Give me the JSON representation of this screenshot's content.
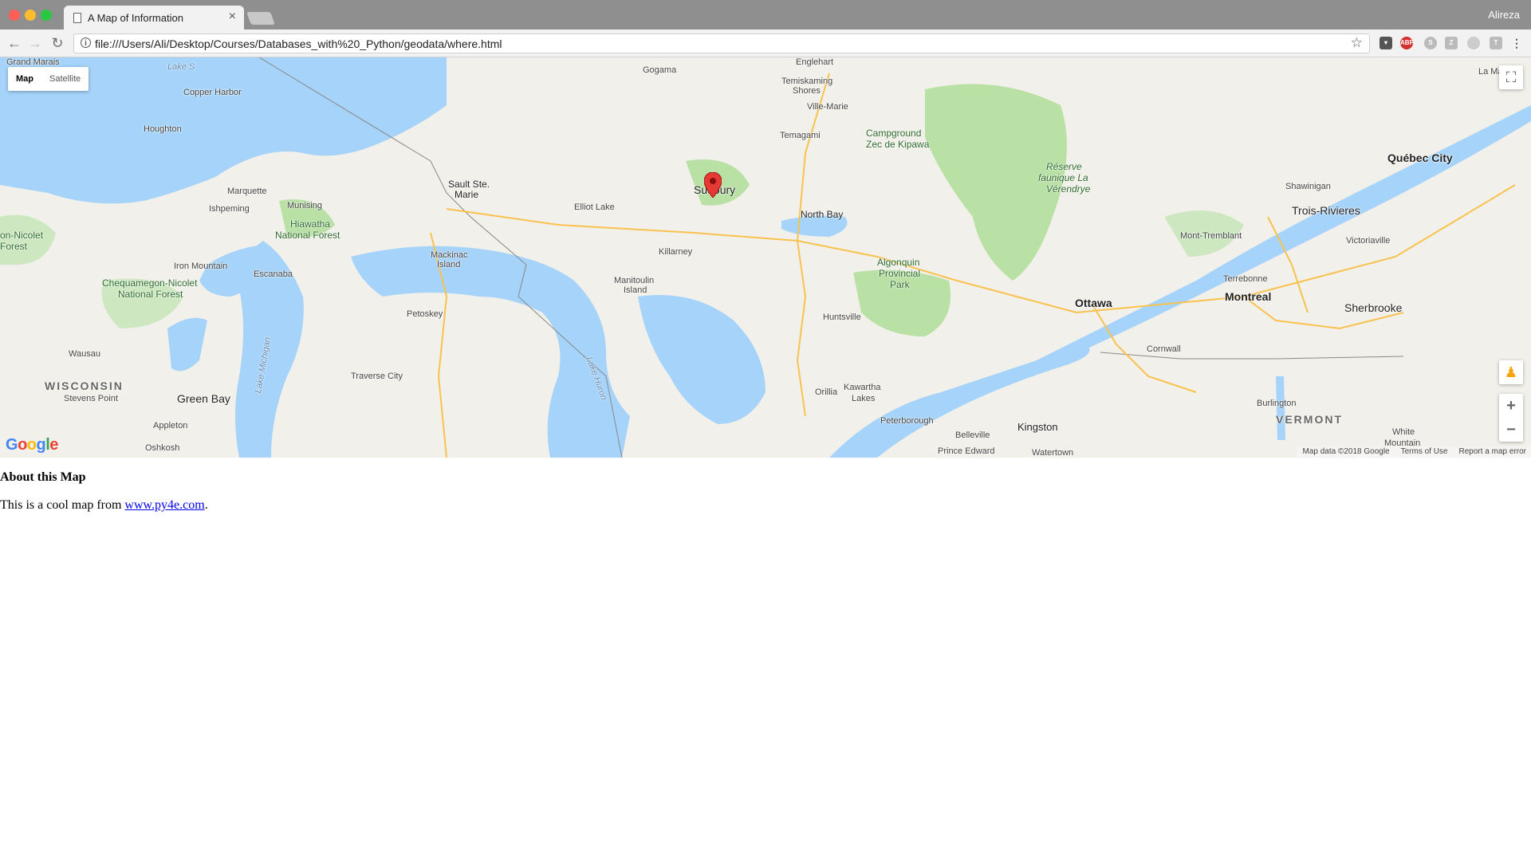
{
  "browser": {
    "tab_title": "A Map of Information",
    "user_name": "Alireza",
    "url": "file:///Users/Ali/Desktop/Courses/Databases_with%20_Python/geodata/where.html",
    "tab_close_icon": "close-icon"
  },
  "map": {
    "map_type_map": "Map",
    "map_type_satellite": "Satellite",
    "attribution_data": "Map data ©2018 Google",
    "attribution_terms": "Terms of Use",
    "attribution_report": "Report a map error",
    "logo_text": "Google",
    "colors": {
      "water": "#a5d3f9",
      "land": "#f2f0ea",
      "park": "#b9e0a5",
      "road": "#f9c24f",
      "pin": "#e53935"
    },
    "labels": {
      "grand_marais": "Grand Marais",
      "lake_superior": "Lake S",
      "copper_harbor": "Copper Harbor",
      "houghton": "Houghton",
      "marquette": "Marquette",
      "ishpeming": "Ishpeming",
      "munising": "Munising",
      "hiawatha": "Hiawatha",
      "national_forest": "National Forest",
      "nicolet": "on-Nicolet",
      "forest": "Forest",
      "iron_mountain": "Iron Mountain",
      "escanaba": "Escanaba",
      "chequamegon": "Chequamegon-Nicolet",
      "chequamegon_forest": "National Forest",
      "wausau": "Wausau",
      "wisconsin": "WISCONSIN",
      "stevens_point": "Stevens Point",
      "green_bay": "Green Bay",
      "appleton": "Appleton",
      "oshkosh": "Oshkosh",
      "lake_michigan": "Lake Michigan",
      "traverse_city": "Traverse City",
      "petoskey": "Petoskey",
      "mackinac": "Mackinac",
      "island": "Island",
      "sault": "Sault Ste.",
      "marie": "Marie",
      "elliot_lake": "Elliot Lake",
      "manitoulin": "Manitoulin",
      "manitoulin_island": "Island",
      "killarney": "Killarney",
      "lake_huron": "Lake Huron",
      "sudbury": "Sudbury",
      "gogama": "Gogama",
      "temiskaming": "Temiskaming",
      "shores": "Shores",
      "ville_marie": "Ville-Marie",
      "englehart": "Englehart",
      "temagami": "Temagami",
      "north_bay": "North Bay",
      "campground": "Campground",
      "zec": "Zec de Kipawa",
      "reserve": "Réserve",
      "faunique": "faunique La",
      "verendrye": "Vérendrye",
      "algonquin": "Algonquin",
      "provincial": "Provincial",
      "park": "Park",
      "huntsville": "Huntsville",
      "orillia": "Orillia",
      "kawartha": "Kawartha",
      "lakes": "Lakes",
      "peterborough": "Peterborough",
      "belleville": "Belleville",
      "prince_edward": "Prince Edward",
      "kingston": "Kingston",
      "watertown": "Watertown",
      "ottawa": "Ottawa",
      "cornwall": "Cornwall",
      "mont_tremblant": "Mont-Tremblant",
      "terrebonne": "Terrebonne",
      "montreal": "Montreal",
      "sherbrooke": "Sherbrooke",
      "burlington": "Burlington",
      "vermont": "VERMONT",
      "white": "White",
      "mountain": "Mountain",
      "trois": "Trois-Rivieres",
      "shawinigan": "Shawinigan",
      "victoriaville": "Victoriaville",
      "quebec": "Québec City",
      "la_ma": "La Ma"
    }
  },
  "content": {
    "heading": "About this Map",
    "text_before": "This is a cool map from ",
    "link_text": "www.py4e.com",
    "text_after": "."
  }
}
